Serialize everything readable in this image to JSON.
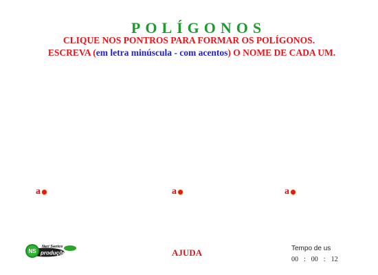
{
  "header": {
    "title": "POLÍGONOS",
    "instruction_line1": "CLIQUE NOS PONTROS PARA FORMAR OS POLÍGONOS.",
    "instruction_line2_start": "ESCREVA (",
    "instruction_line2_blue": "em letra minúscula - com acentos",
    "instruction_line2_end": ") O NOME DE CADA UM."
  },
  "points": [
    {
      "label": "a"
    },
    {
      "label": "a"
    },
    {
      "label": "a"
    }
  ],
  "logo": {
    "initials": "NS",
    "name": "Neri Santos",
    "subtitle": "produções"
  },
  "footer": {
    "help_label": "AJUDA",
    "timer_label": "Tempo de us",
    "timer": {
      "hours": "00",
      "minutes": "00",
      "seconds": "12",
      "separator": ":"
    }
  },
  "colors": {
    "title": "#1e9a2e",
    "instruction_red": "#e8151b",
    "instruction_blue": "#1e1ed2",
    "point": "#e81818"
  }
}
